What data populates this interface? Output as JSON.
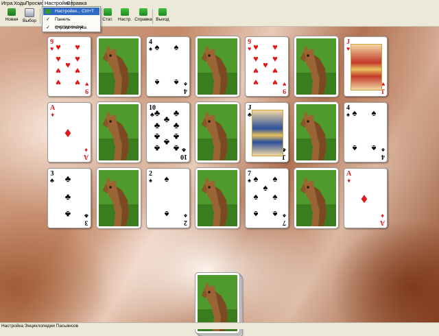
{
  "menu": {
    "items": [
      {
        "label": "Игра",
        "name": "menu-game"
      },
      {
        "label": "Ходы",
        "name": "menu-moves"
      },
      {
        "label": "Просмотр",
        "name": "menu-view"
      },
      {
        "label": "Настройки",
        "name": "menu-settings"
      },
      {
        "label": "Справка",
        "name": "menu-help"
      }
    ]
  },
  "toolbar": {
    "new_label": "Новая",
    "choose_label": "Выбор",
    "stats_label": "Стат.",
    "settings_label": "Настр.",
    "help_label": "Справка",
    "exit_label": "Выход"
  },
  "dropdown": {
    "items": [
      {
        "label": "Настройки...",
        "shortcut": "Ctrl+T",
        "highlighted": true
      },
      {
        "label": "Панель инструментов",
        "checked": true
      },
      {
        "label": "Строка статуса",
        "checked": true
      }
    ]
  },
  "tableau": {
    "rows": [
      [
        {
          "face": "up",
          "rank": "9",
          "suit": "♥",
          "color": "red"
        },
        {
          "face": "down"
        },
        {
          "face": "up",
          "rank": "4",
          "suit": "♠",
          "color": "black"
        },
        {
          "face": "down"
        },
        {
          "face": "up",
          "rank": "9",
          "suit": "♥",
          "color": "red"
        },
        {
          "face": "down"
        },
        {
          "face": "up",
          "rank": "J",
          "suit": "♥",
          "color": "red",
          "court": true
        }
      ],
      [
        {
          "face": "up",
          "rank": "A",
          "suit": "♦",
          "color": "red"
        },
        {
          "face": "down"
        },
        {
          "face": "up",
          "rank": "10",
          "suit": "♣",
          "color": "black"
        },
        {
          "face": "down"
        },
        {
          "face": "up",
          "rank": "J",
          "suit": "♣",
          "color": "black",
          "court": true
        },
        {
          "face": "down"
        },
        {
          "face": "up",
          "rank": "4",
          "suit": "♠",
          "color": "black"
        }
      ],
      [
        {
          "face": "up",
          "rank": "3",
          "suit": "♣",
          "color": "black"
        },
        {
          "face": "down"
        },
        {
          "face": "up",
          "rank": "2",
          "suit": "♠",
          "color": "black"
        },
        {
          "face": "down"
        },
        {
          "face": "up",
          "rank": "7",
          "suit": "♠",
          "color": "black"
        },
        {
          "face": "down"
        },
        {
          "face": "up",
          "rank": "A",
          "suit": "♦",
          "color": "red"
        }
      ]
    ]
  },
  "stock": {
    "face": "down"
  },
  "status": {
    "text": "Настройка Энциклопедии Пасьянсов"
  },
  "colors": {
    "card_back": "#3f8a22",
    "red_suit": "#e01818",
    "highlight": "#316ac5"
  }
}
